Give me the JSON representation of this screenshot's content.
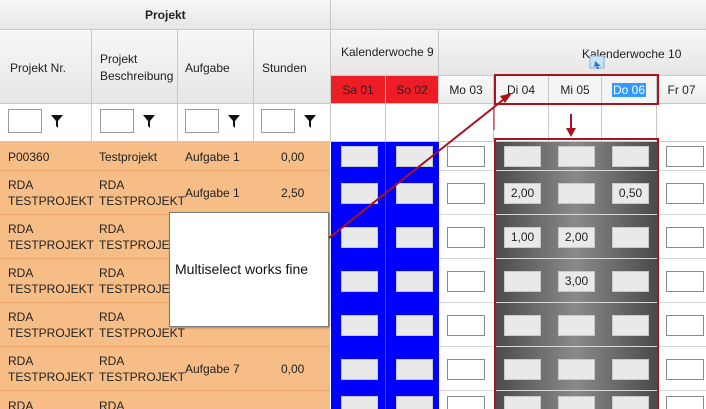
{
  "header": {
    "projekt_group": "Projekt",
    "columns": {
      "projekt_nr": "Projekt Nr.",
      "projekt_beschreibung_line1": "Projekt",
      "projekt_beschreibung_line2": "Beschreibung",
      "aufgabe": "Aufgabe",
      "stunden": "Stunden"
    },
    "weeks": {
      "kw9": "Kalenderwoche 9",
      "kw10": "Kalenderwoche 10"
    },
    "days": [
      "Sa 01",
      "So 02",
      "Mo 03",
      "Di 04",
      "Mi 05",
      "Do 06",
      "Fr 07"
    ]
  },
  "rows": [
    {
      "nr1": "P00360",
      "nr2": "",
      "desc1": "Testprojekt",
      "desc2": "",
      "aufgabe": "Aufgabe 1",
      "stunden": "0,00",
      "di": "",
      "mi": "",
      "do": ""
    },
    {
      "nr1": "RDA",
      "nr2": "TESTPROJEKT",
      "desc1": "RDA",
      "desc2": "TESTPROJEKT",
      "aufgabe": "Aufgabe 1",
      "stunden": "2,50",
      "di": "2,00",
      "mi": "",
      "do": "0,50"
    },
    {
      "nr1": "RDA",
      "nr2": "TESTPROJEKT",
      "desc1": "RDA",
      "desc2": "TESTPROJEKT",
      "aufgabe": "",
      "stunden": "",
      "di": "1,00",
      "mi": "2,00",
      "do": ""
    },
    {
      "nr1": "RDA",
      "nr2": "TESTPROJEKT",
      "desc1": "RDA",
      "desc2": "TESTPROJEKT",
      "aufgabe": "",
      "stunden": "",
      "di": "",
      "mi": "3,00",
      "do": ""
    },
    {
      "nr1": "RDA",
      "nr2": "TESTPROJEKT",
      "desc1": "RDA",
      "desc2": "TESTPROJEKT",
      "aufgabe": "",
      "stunden": "",
      "di": "",
      "mi": "",
      "do": ""
    },
    {
      "nr1": "RDA",
      "nr2": "TESTPROJEKT",
      "desc1": "RDA",
      "desc2": "TESTPROJEKT",
      "aufgabe": "Aufgabe 7",
      "stunden": "0,00",
      "di": "",
      "mi": "",
      "do": ""
    },
    {
      "nr1": "RDA",
      "nr2": "",
      "desc1": "RDA",
      "desc2": "",
      "aufgabe": "",
      "stunden": "",
      "di": "",
      "mi": "",
      "do": ""
    }
  ],
  "callout": {
    "text": "Multiselect works fine"
  },
  "colors": {
    "weekend": "#ee1c24",
    "blue_cells": "#0000ff",
    "project_rows": "#f7bd87",
    "highlight": "#a8141e"
  },
  "icons": {
    "filter": "funnel-icon",
    "drag": "drag-cursor-icon"
  }
}
